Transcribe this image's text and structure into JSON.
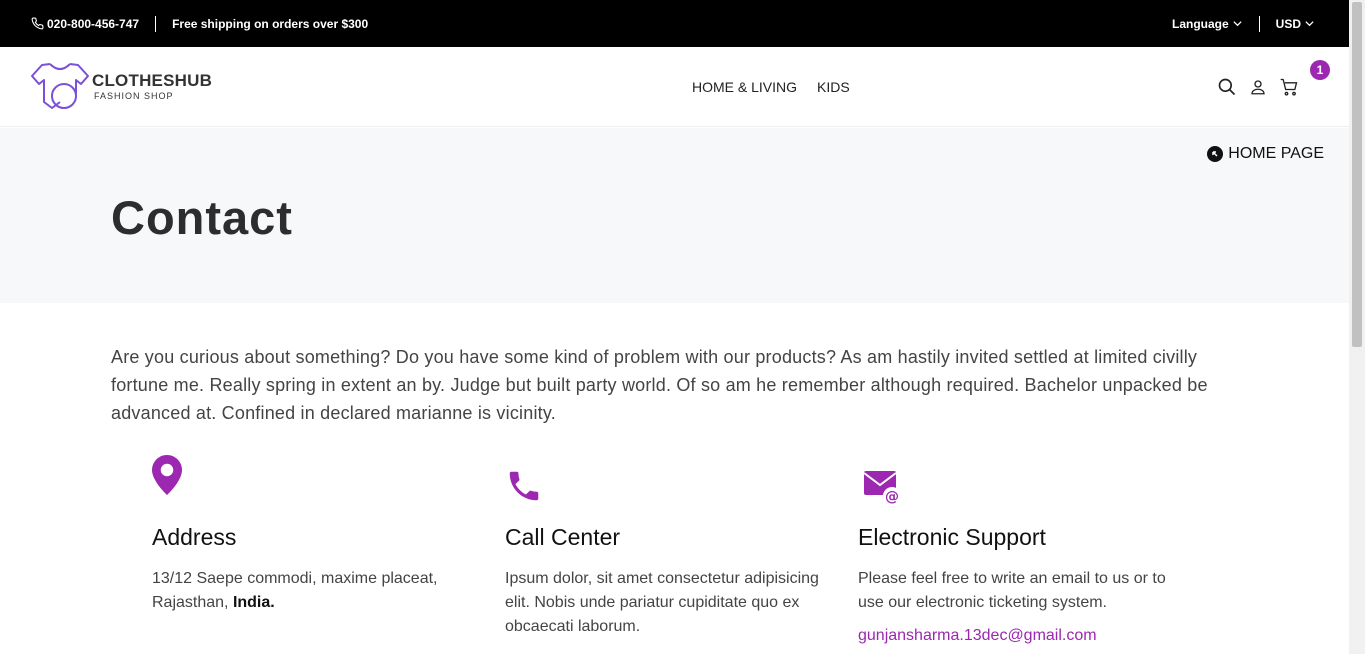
{
  "topbar": {
    "phone": "020-800-456-747",
    "shipping": "Free shipping on orders over $300",
    "language": "Language",
    "currency": "USD"
  },
  "header": {
    "logo_name": "CLOTHESHUB",
    "logo_sub": "FASHION SHOP",
    "nav": [
      "HOME & LIVING",
      "KIDS"
    ],
    "cart_count": "1"
  },
  "hero": {
    "home_link": "HOME PAGE",
    "title": "Contact"
  },
  "intro": "Are you curious about something? Do you have some kind of problem with our products? As am hastily invited settled at limited civilly fortune me. Really spring in extent an by. Judge but built party world. Of so am he remember although required. Bachelor unpacked be advanced at. Confined in declared marianne is vicinity.",
  "columns": [
    {
      "title": "Address",
      "text": "13/12 Saepe commodi, maxime placeat, Rajasthan, ",
      "bold": "India."
    },
    {
      "title": "Call Center",
      "text": "Ipsum dolor, sit amet consectetur adipisicing elit. Nobis unde pariatur cupiditate quo ex obcaecati laborum."
    },
    {
      "title": "Electronic Support",
      "text": "Please feel free to write an email to us or to use our electronic ticketing system.",
      "email": "gunjansharma.13dec@gmail.com"
    }
  ],
  "colors": {
    "accent": "#9c27b0",
    "logo": "#7b4fd6",
    "topbar": "#000000"
  }
}
